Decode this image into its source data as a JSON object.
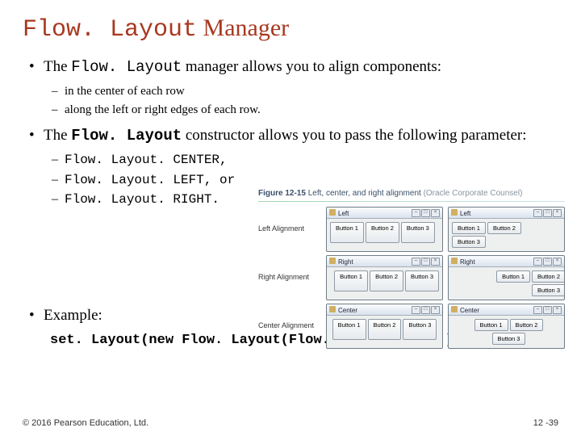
{
  "title": {
    "mono": "Flow. Layout",
    "rest": " Manager"
  },
  "bullets": {
    "b1_pre": "The ",
    "b1_mono": "Flow. Layout",
    "b1_post": " manager allows you to align components:",
    "b1_sub1": "in the center of each row",
    "b1_sub2": "along the left or right edges of each row.",
    "b2_pre": "The ",
    "b2_mono": "Flow. Layout",
    "b2_post": " constructor allows you to pass the following parameter:",
    "b2_sub1": "Flow. Layout. CENTER,",
    "b2_sub2": "Flow. Layout. LEFT, or",
    "b2_sub3": "Flow. Layout. RIGHT.",
    "b3": "Example:"
  },
  "code": "set. Layout(new Flow. Layout(Flow. Layout. LEFT));",
  "figure": {
    "num": "Figure 12-15",
    "caption": "Left, center, and right alignment",
    "source": "(Oracle Corporate Counsel)",
    "rows": [
      {
        "label": "Left Alignment",
        "cap": "Left"
      },
      {
        "label": "Right Alignment",
        "cap": "Right"
      },
      {
        "label": "Center Alignment",
        "cap": "Center"
      }
    ],
    "buttons": [
      "Button 1",
      "Button 2",
      "Button 3"
    ],
    "ctrls": {
      "min": "–",
      "max": "□",
      "close": "×"
    }
  },
  "footer": {
    "copyright": "© 2016 Pearson Education, Ltd.",
    "page": "12 -39"
  }
}
